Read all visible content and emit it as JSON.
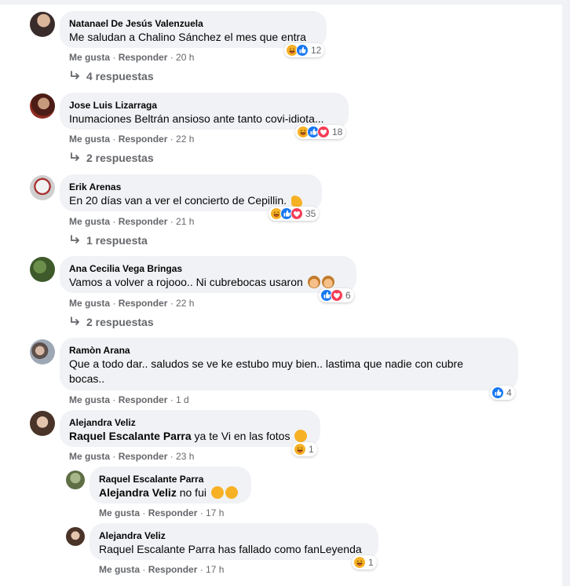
{
  "labels": {
    "like": "Me gusta",
    "reply": "Responder",
    "sep": " · "
  },
  "colors": {
    "like": "#1877f2",
    "love": "#f33e58",
    "haha": "#f7b125",
    "bubble": "#f0f2f5"
  },
  "comments": [
    {
      "name": "Natanael De Jesús Valenzuela",
      "text": "Me saludan a Chalino Sánchez el mes que entra",
      "time": "20 h",
      "reactions": [
        "haha",
        "like"
      ],
      "count": "12",
      "replies": "4 respuestas"
    },
    {
      "name": "Jose Luis Lizarraga",
      "text": "Inumaciones Beltrán ansioso ante tanto covi-idiota...",
      "time": "22 h",
      "reactions": [
        "haha",
        "like",
        "love"
      ],
      "count": "18",
      "replies": "2 respuestas"
    },
    {
      "name": "Erik Arenas",
      "text": "En 20 días van a ver el concierto de Cepillin.",
      "text_emoji": "muscle-emoji",
      "time": "21 h",
      "reactions": [
        "haha",
        "like",
        "love"
      ],
      "count": "35",
      "replies": "1 respuesta"
    },
    {
      "name": "Ana Cecilia Vega Bringas",
      "text": "Vamos a volver a rojooo.. Ni cubrebocas usaron",
      "text_emoji": "woman-facepalming-emoji",
      "time": "22 h",
      "reactions": [
        "like",
        "love"
      ],
      "count": "6",
      "replies": "2 respuestas"
    },
    {
      "name": "Ramòn Arana",
      "text_line1": "Que a todo dar.. saludos se ve ke estubo muy bien.. lastima que nadie con cubre",
      "text_line2": "bocas..",
      "time": "1 d",
      "reactions": [
        "like"
      ],
      "count": "4"
    },
    {
      "name": "Alejandra Veliz",
      "mention": "Raquel Escalante Parra",
      "text": "ya te Vi en las fotos",
      "text_emoji": "laughing-emoji",
      "time": "23 h",
      "reactions": [
        "haha"
      ],
      "count": "1"
    }
  ],
  "nested": [
    {
      "name": "Raquel Escalante Parra",
      "mention": "Alejandra Veliz",
      "text": "no fui",
      "text_emoji": "pleading-face-emoji",
      "time": "17 h"
    },
    {
      "name": "Alejandra Veliz",
      "text": "Raquel Escalante Parra has fallado como fanLeyenda",
      "time": "17 h",
      "reactions": [
        "haha"
      ],
      "count": "1"
    }
  ]
}
